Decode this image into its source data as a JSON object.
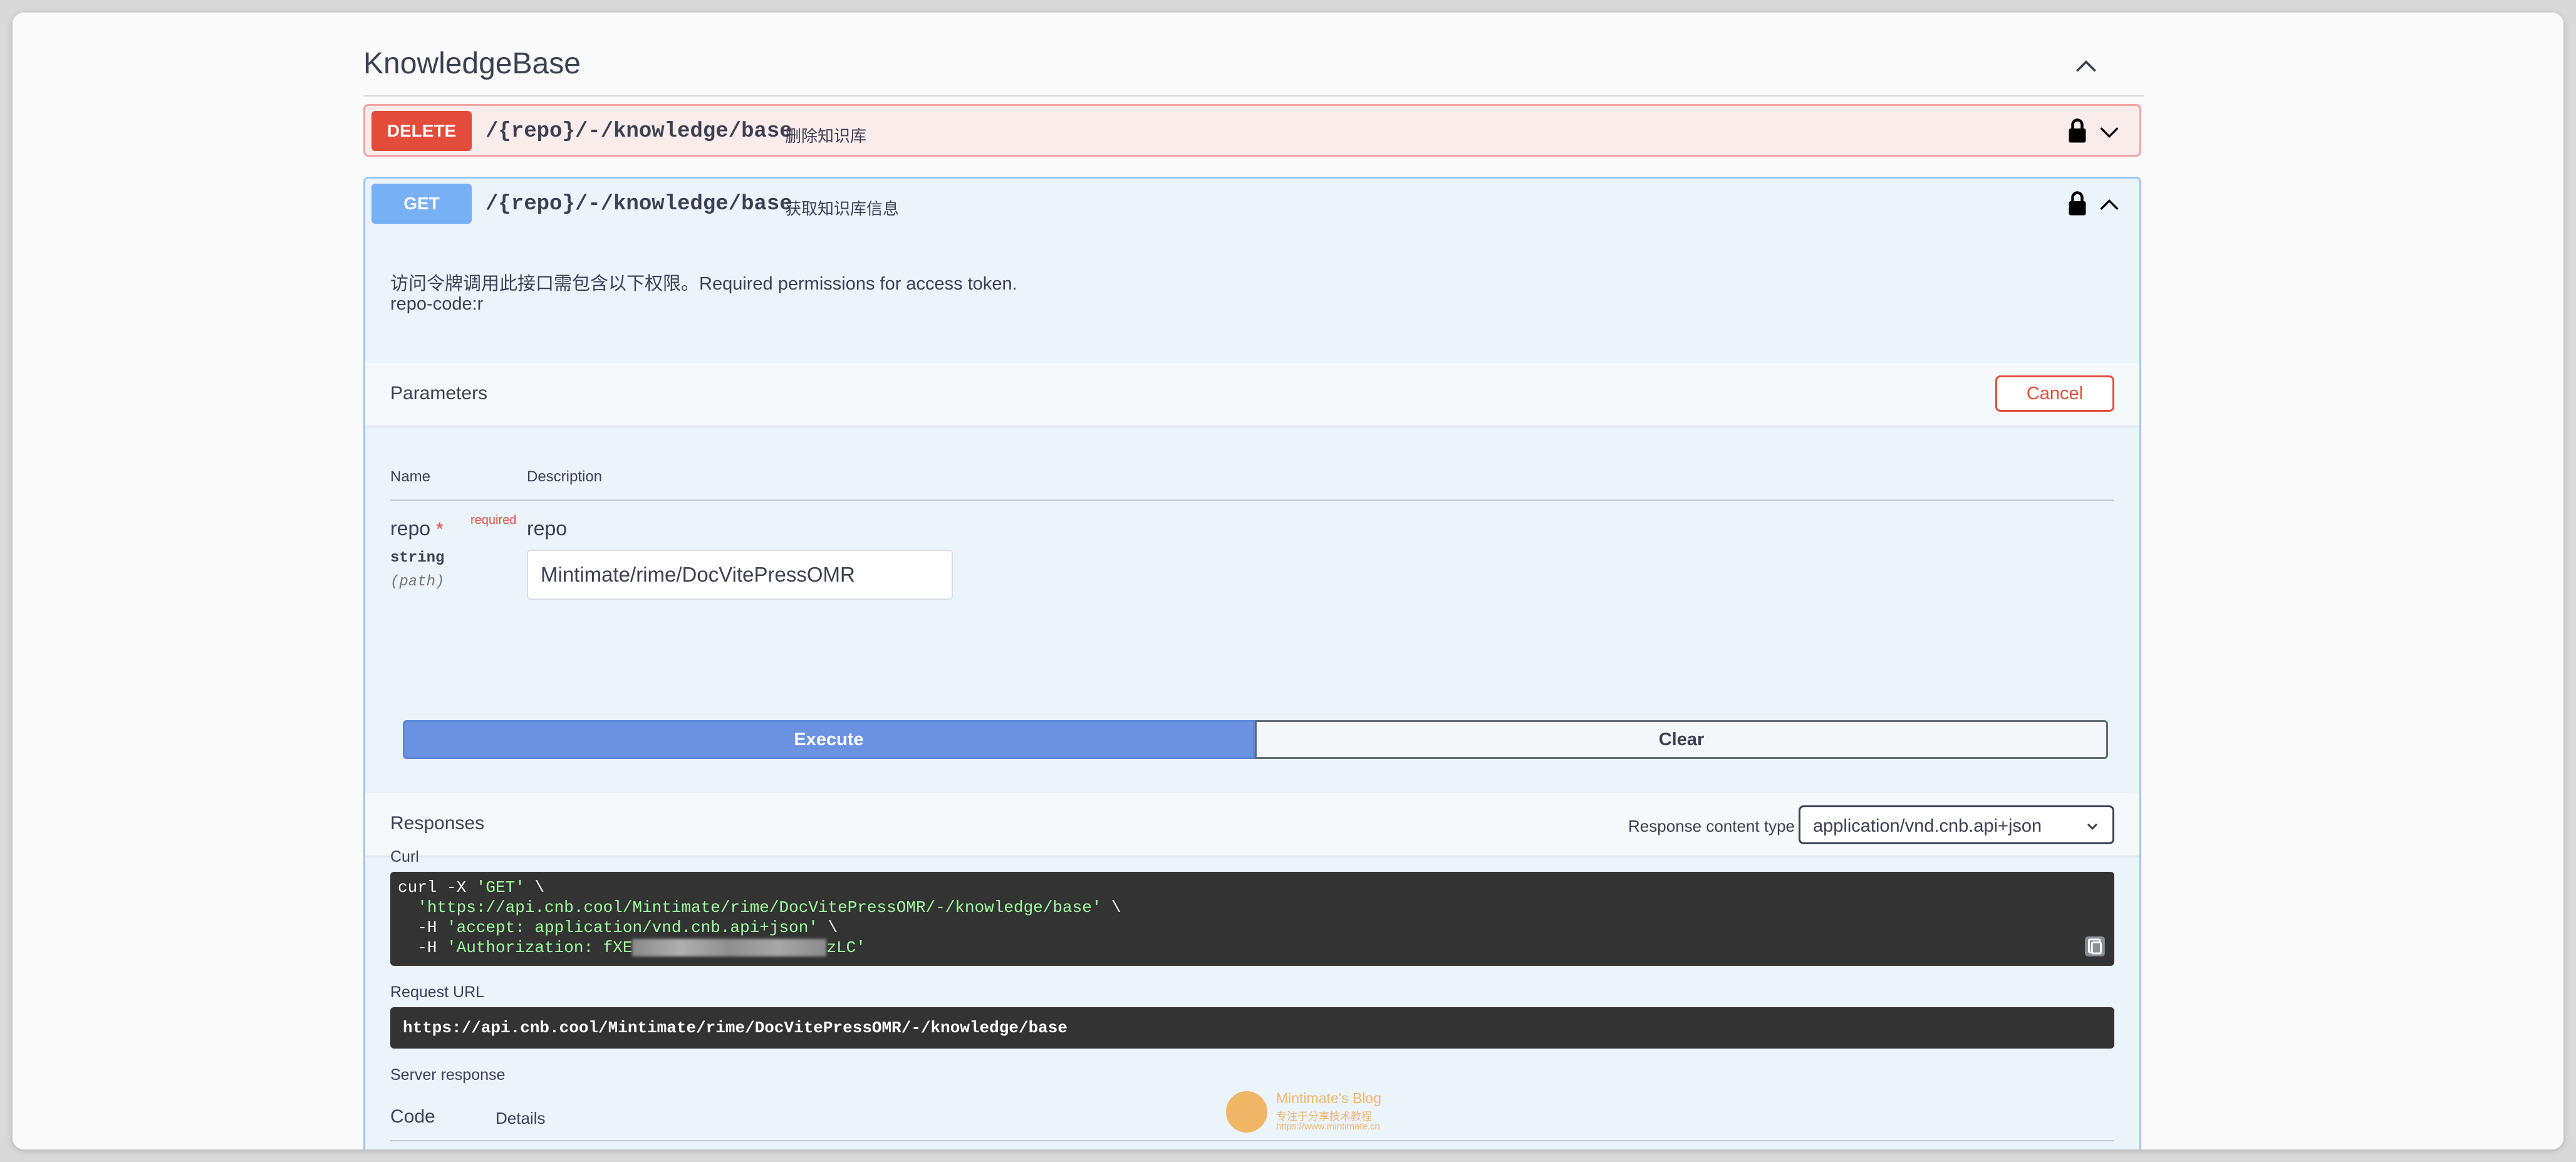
{
  "section": {
    "title": "KnowledgeBase"
  },
  "operations": [
    {
      "method": "DELETE",
      "path": "/{repo}/-/knowledge/base",
      "description": "删除知识库",
      "color": "#e34c3b"
    },
    {
      "method": "GET",
      "path": "/{repo}/-/knowledge/base",
      "description": "获取知识库信息",
      "color": "#77b0f5"
    }
  ],
  "get_op": {
    "notice_line1": "访问令牌调用此接口需包含以下权限。Required permissions for access token.",
    "notice_line2": "repo-code:r",
    "parameters_label": "Parameters",
    "cancel_label": "Cancel",
    "col_name": "Name",
    "col_description": "Description",
    "param": {
      "name": "repo",
      "required_star": "*",
      "required_text": "required",
      "type": "string",
      "in": "(path)",
      "description": "repo",
      "value": "Mintimate/rime/DocVitePressOMR"
    },
    "execute_label": "Execute",
    "clear_label": "Clear",
    "responses_label": "Responses",
    "response_content_type_label": "Response content type",
    "response_content_type_value": "application/vnd.cnb.api+json",
    "curl_label": "Curl",
    "curl": {
      "line1_a": "curl -X ",
      "line1_b": "'GET'",
      "line1_c": " \\",
      "line2_a": "  ",
      "line2_b": "'https://api.cnb.cool/Mintimate/rime/DocVitePressOMR/-/knowledge/base'",
      "line2_c": " \\",
      "line3_a": "  -H ",
      "line3_b": "'accept: application/vnd.cnb.api+json'",
      "line3_c": " \\",
      "line4_a": "  -H ",
      "line4_b1": "'Authorization: fXE",
      "line4_b2": "zLC'"
    },
    "request_url_label": "Request URL",
    "request_url": "https://api.cnb.cool/Mintimate/rime/DocVitePressOMR/-/knowledge/base",
    "server_response_label": "Server response",
    "code_label": "Code",
    "details_label": "Details"
  },
  "watermark": {
    "title": "Mintimate's Blog",
    "subtitle": "专注于分享技术教程",
    "url": "https://www.mintimate.cn"
  }
}
